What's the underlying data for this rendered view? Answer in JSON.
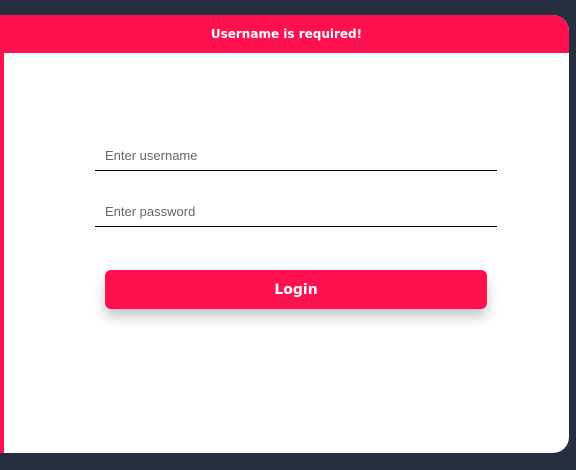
{
  "error_banner": {
    "message": "Username is required!"
  },
  "form": {
    "username_placeholder": "Enter username",
    "username_value": "",
    "password_placeholder": "Enter password",
    "password_value": "",
    "login_label": "Login"
  },
  "colors": {
    "accent": "#ff1150",
    "background": "#252f40",
    "card": "#ffffff"
  }
}
